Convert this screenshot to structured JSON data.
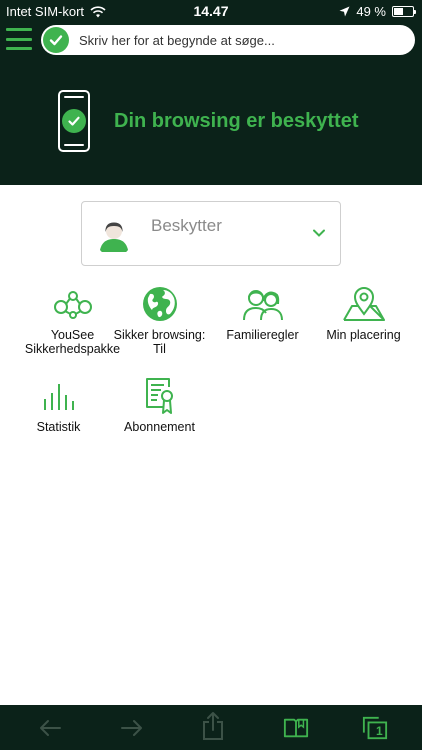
{
  "status_bar": {
    "carrier": "Intet SIM-kort",
    "time": "14.47",
    "battery_text": "49 %",
    "battery_level": 0.49
  },
  "search": {
    "placeholder": "Skriv her for at begynde at søge..."
  },
  "hero": {
    "title": "Din browsing er beskyttet"
  },
  "profile": {
    "selected": "Beskytter"
  },
  "menu": {
    "items": [
      {
        "line1": "YouSee",
        "line2": "Sikkerhedspakke",
        "icon": "network-icon"
      },
      {
        "line1": "Sikker browsing:",
        "line2": "Til",
        "icon": "globe-icon"
      },
      {
        "line1": "Familieregler",
        "line2": "",
        "icon": "family-icon"
      },
      {
        "line1": "Min placering",
        "line2": "",
        "icon": "location-map-icon"
      },
      {
        "line1": "Statistik",
        "line2": "",
        "icon": "statistics-icon"
      },
      {
        "line1": "Abonnement",
        "line2": "",
        "icon": "subscription-certificate-icon"
      }
    ]
  },
  "toolbar": {
    "icons": [
      "back-arrow-icon",
      "forward-arrow-icon",
      "share-icon",
      "bookmarks-icon",
      "tabs-icon"
    ],
    "tab_count": "1"
  },
  "colors": {
    "dark_bg": "#0b2219",
    "accent_green": "#3fb34f",
    "disabled_icon": "#3c5247"
  }
}
